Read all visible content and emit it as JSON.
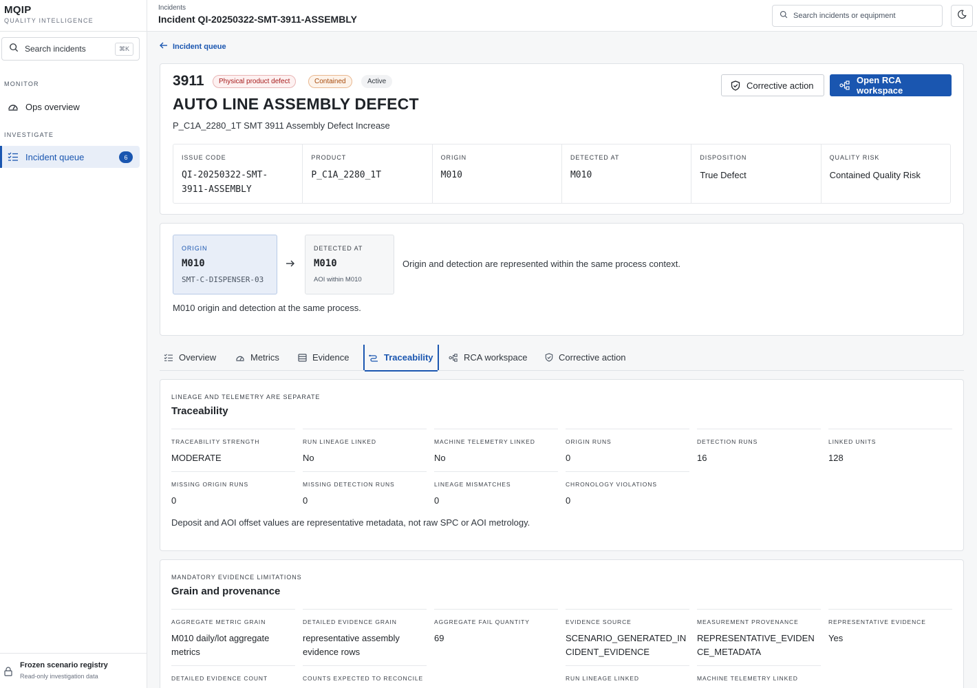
{
  "brand": {
    "name": "MQIP",
    "subtitle": "QUALITY INTELLIGENCE"
  },
  "sidebar": {
    "search_label": "Search incidents",
    "search_shortcut": "⌘K",
    "sections": [
      {
        "label": "MONITOR",
        "items": [
          {
            "label": "Ops overview",
            "icon": "gauge-icon"
          }
        ]
      },
      {
        "label": "INVESTIGATE",
        "items": [
          {
            "label": "Incident queue",
            "icon": "list-icon",
            "count": "6",
            "active": true
          }
        ]
      }
    ],
    "footer": {
      "title": "Frozen scenario registry",
      "subtitle": "Read-only investigation data",
      "icon": "lock-icon"
    }
  },
  "topbar": {
    "breadcrumb": "Incidents",
    "title": "Incident QI-20250322-SMT-3911-ASSEMBLY",
    "search_placeholder": "Search incidents or equipment",
    "theme_icon": "moon-icon"
  },
  "back_link": "Incident queue",
  "incident": {
    "number": "3911",
    "badges": {
      "defect": "Physical product defect",
      "containment": "Contained",
      "status": "Active"
    },
    "title": "AUTO LINE ASSEMBLY DEFECT",
    "subtitle": "P_C1A_2280_1T SMT 3911 Assembly Defect Increase",
    "actions": {
      "corrective": "Corrective action",
      "rca": "Open RCA workspace"
    },
    "meta": {
      "issue_code_label": "ISSUE CODE",
      "issue_code": "QI-20250322-SMT-3911-ASSEMBLY",
      "product_label": "PRODUCT",
      "product": "P_C1A_2280_1T",
      "origin_label": "ORIGIN",
      "origin": "M010",
      "detected_label": "DETECTED AT",
      "detected": "M010",
      "disposition_label": "DISPOSITION",
      "disposition": "True Defect",
      "risk_label": "QUALITY RISK",
      "risk": "Contained Quality Risk"
    }
  },
  "flow": {
    "origin_label": "ORIGIN",
    "origin_value": "M010",
    "origin_equipment": "SMT-C-DISPENSER-03",
    "detected_label": "DETECTED AT",
    "detected_value": "M010",
    "detected_sub": "AOI within M010",
    "note": "Origin and detection are represented within the same process context.",
    "footer": "M010 origin and detection at the same process."
  },
  "tabs": [
    {
      "label": "Overview",
      "icon": "list-icon"
    },
    {
      "label": "Metrics",
      "icon": "gauge-icon"
    },
    {
      "label": "Evidence",
      "icon": "database-icon"
    },
    {
      "label": "Traceability",
      "icon": "trace-icon",
      "active": true
    },
    {
      "label": "RCA workspace",
      "icon": "network-icon"
    },
    {
      "label": "Corrective action",
      "icon": "shield-check-icon"
    }
  ],
  "traceability": {
    "eyebrow": "LINEAGE AND TELEMETRY ARE SEPARATE",
    "title": "Traceability",
    "fields": [
      {
        "label": "TRACEABILITY STRENGTH",
        "value": "MODERATE"
      },
      {
        "label": "RUN LINEAGE LINKED",
        "value": "No"
      },
      {
        "label": "MACHINE TELEMETRY LINKED",
        "value": "No"
      },
      {
        "label": "ORIGIN RUNS",
        "value": "0"
      },
      {
        "label": "DETECTION RUNS",
        "value": "16"
      },
      {
        "label": "LINKED UNITS",
        "value": "128"
      },
      {
        "label": "MISSING ORIGIN RUNS",
        "value": "0"
      },
      {
        "label": "MISSING DETECTION RUNS",
        "value": "0"
      },
      {
        "label": "LINEAGE MISMATCHES",
        "value": "0"
      },
      {
        "label": "CHRONOLOGY VIOLATIONS",
        "value": "0"
      }
    ],
    "note": "Deposit and AOI offset values are representative metadata, not raw SPC or AOI metrology."
  },
  "grain": {
    "eyebrow": "MANDATORY EVIDENCE LIMITATIONS",
    "title": "Grain and provenance",
    "fields": [
      {
        "label": "AGGREGATE METRIC GRAIN",
        "value": "M010 daily/lot aggregate metrics"
      },
      {
        "label": "DETAILED EVIDENCE GRAIN",
        "value": "representative assembly evidence rows"
      },
      {
        "label": "AGGREGATE FAIL QUANTITY",
        "value": "69"
      },
      {
        "label": "EVIDENCE SOURCE",
        "value": "SCENARIO_GENERATED_INCIDENT_EVIDENCE"
      },
      {
        "label": "MEASUREMENT PROVENANCE",
        "value": "REPRESENTATIVE_EVIDENCE_METADATA"
      },
      {
        "label": "REPRESENTATIVE EVIDENCE",
        "value": "Yes"
      },
      {
        "label": "DETAILED EVIDENCE COUNT",
        "value": ""
      },
      {
        "label": "COUNTS EXPECTED TO RECONCILE",
        "value": ""
      },
      {
        "label": "RUN LINEAGE LINKED",
        "value": ""
      },
      {
        "label": "MACHINE TELEMETRY LINKED",
        "value": ""
      }
    ]
  },
  "colors": {
    "accent": "#1a56b0",
    "danger": "#a61b1b",
    "warning": "#a74b0c"
  }
}
